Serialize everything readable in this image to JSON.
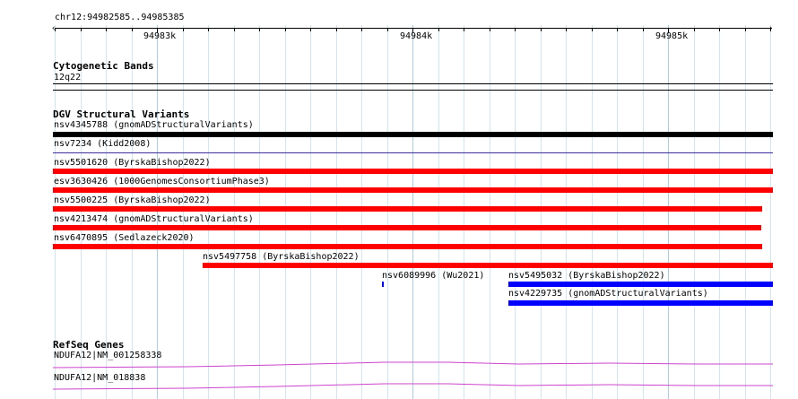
{
  "ruler": {
    "region": "chr12:94982585..94985385",
    "ticks": [
      "94983k",
      "94984k",
      "94985k"
    ]
  },
  "cytoband": {
    "title": "Cytogenetic Bands",
    "band": "12q22"
  },
  "dgv": {
    "title": "DGV Structural Variants",
    "variants": [
      {
        "label": "nsv4345788 (gnomADStructuralVariants)",
        "style": "bar",
        "color": "#000000"
      },
      {
        "label": "nsv7234 (Kidd2008)",
        "style": "line",
        "color": "#3f2f9f"
      },
      {
        "label": "nsv5501620 (ByrskaBishop2022)",
        "style": "bar",
        "color": "#ff0000"
      },
      {
        "label": "esv3630426 (1000GenomesConsortiumPhase3)",
        "style": "bar",
        "color": "#ff0000"
      },
      {
        "label": "nsv5500225 (ByrskaBishop2022)",
        "style": "bar",
        "color": "#ff0000"
      },
      {
        "label": "nsv4213474 (gnomADStructuralVariants)",
        "style": "bar",
        "color": "#ff0000"
      },
      {
        "label": "nsv6470895 (Sedlazeck2020)",
        "style": "bar",
        "color": "#ff0000"
      },
      {
        "label": "nsv5497758 (ByrskaBishop2022)",
        "style": "bar",
        "color": "#ff0000"
      },
      {
        "label": "nsv6089996 (Wu2021)",
        "style": "mark",
        "color": "#0000ff"
      },
      {
        "label": "nsv5495032 (ByrskaBishop2022)",
        "style": "bar",
        "color": "#0000ff"
      },
      {
        "label": "nsv4229735 (gnomADStructuralVariants)",
        "style": "bar",
        "color": "#0000ff"
      }
    ]
  },
  "refseq": {
    "title": "RefSeq Genes",
    "genes": [
      {
        "label": "NDUFA12|NM_001258338",
        "color": "#cc44cc"
      },
      {
        "label": "NDUFA12|NM_018838",
        "color": "#cc44cc"
      }
    ]
  }
}
